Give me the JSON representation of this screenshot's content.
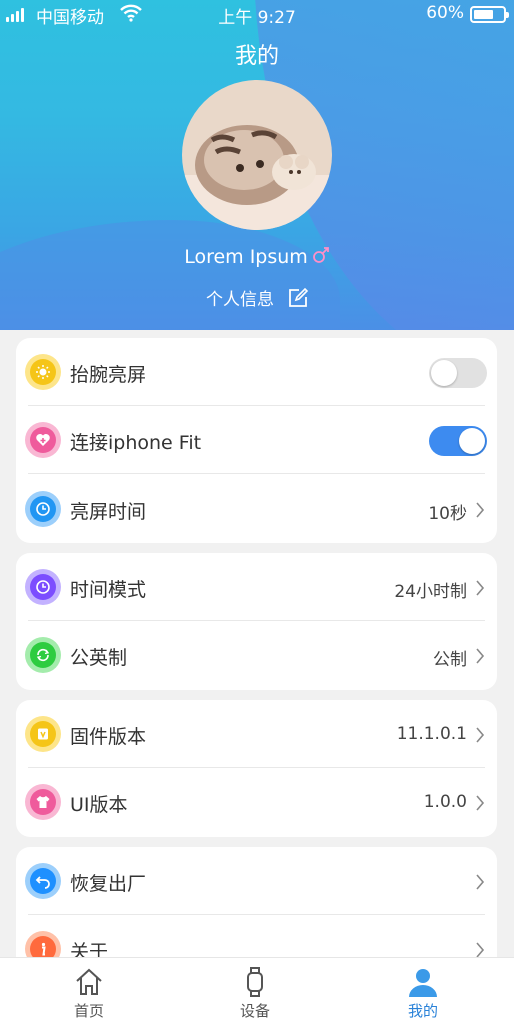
{
  "status_bar": {
    "carrier": "中国移动",
    "time": "上午 9:27",
    "battery": "60%"
  },
  "header": {
    "title": "我的",
    "username": "Lorem Ipsum",
    "profile_link": "个人信息"
  },
  "groups": [
    {
      "items": [
        {
          "label": "抬腕亮屏",
          "toggle": false,
          "icon": "sun-icon",
          "color": "#f5c518"
        },
        {
          "label": "连接iphone Fit",
          "toggle": true,
          "icon": "heart-plus-icon",
          "color": "#ef5b9c"
        },
        {
          "label": "亮屏时间",
          "value": "10秒",
          "icon": "timer-icon",
          "color": "#2196f3"
        }
      ]
    },
    {
      "items": [
        {
          "label": "时间模式",
          "value": "24小时制",
          "icon": "clock-icon",
          "color": "#7c4dff"
        },
        {
          "label": "公英制",
          "value": "公制",
          "icon": "exchange-icon",
          "color": "#2ecc40"
        }
      ]
    },
    {
      "items": [
        {
          "label": "固件版本",
          "value": "11.1.0.1",
          "icon": "firmware-icon",
          "color": "#f5c518"
        },
        {
          "label": "UI版本",
          "value": "1.0.0",
          "icon": "shirt-icon",
          "color": "#ef5b9c"
        }
      ]
    },
    {
      "items": [
        {
          "label": "恢复出厂",
          "icon": "undo-icon",
          "color": "#1e90ff"
        },
        {
          "label": "关于",
          "icon": "info-icon",
          "color": "#ff6a3d"
        }
      ]
    }
  ],
  "tabbar": {
    "tabs": [
      {
        "label": "首页",
        "icon": "home-icon",
        "active": false
      },
      {
        "label": "设备",
        "icon": "watch-icon",
        "active": false
      },
      {
        "label": "我的",
        "icon": "user-icon",
        "active": true
      }
    ]
  },
  "colors": {
    "accent": "#3d8bf0",
    "tab_active": "#2a82d8",
    "header_start": "#2fc1e0",
    "header_end": "#4b8fe6"
  }
}
